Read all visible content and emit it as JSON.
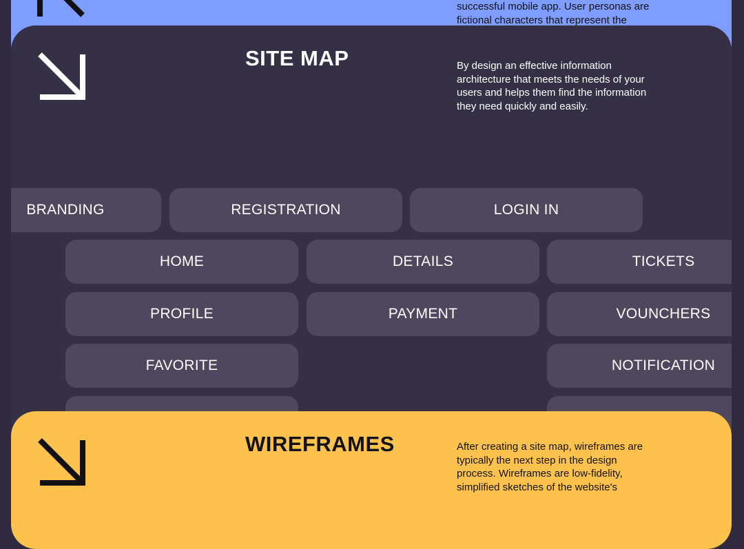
{
  "personas_section": {
    "description_fragment": "successful mobile app. User personas are fictional characters that represent the"
  },
  "site_map": {
    "title": "SITE MAP",
    "description": "By design an effective information architecture that meets the needs of your users and helps them find the information they need quickly and easily.",
    "row1": [
      "BRANDING",
      "REGISTRATION",
      "LOGIN IN"
    ],
    "col1": [
      "HOME",
      "PROFILE",
      "FAVORITE"
    ],
    "col2": [
      "DETAILS",
      "PAYMENT"
    ],
    "col3": [
      "TICKETS",
      "VOUNCHERS",
      "NOTIFICATION"
    ]
  },
  "wireframes": {
    "title": "WIREFRAMES",
    "description": "After creating a site map, wireframes are typically the next step in the design process. Wireframes are low-fidelity, simplified sketches of the website's"
  },
  "colors": {
    "personas_card": "#7f9cff",
    "site_map_card": "#353045",
    "pill": "#4e475e",
    "wireframes_card": "#fdc24d"
  },
  "icons": [
    "arrow-up-left-icon",
    "arrow-down-right-icon"
  ]
}
